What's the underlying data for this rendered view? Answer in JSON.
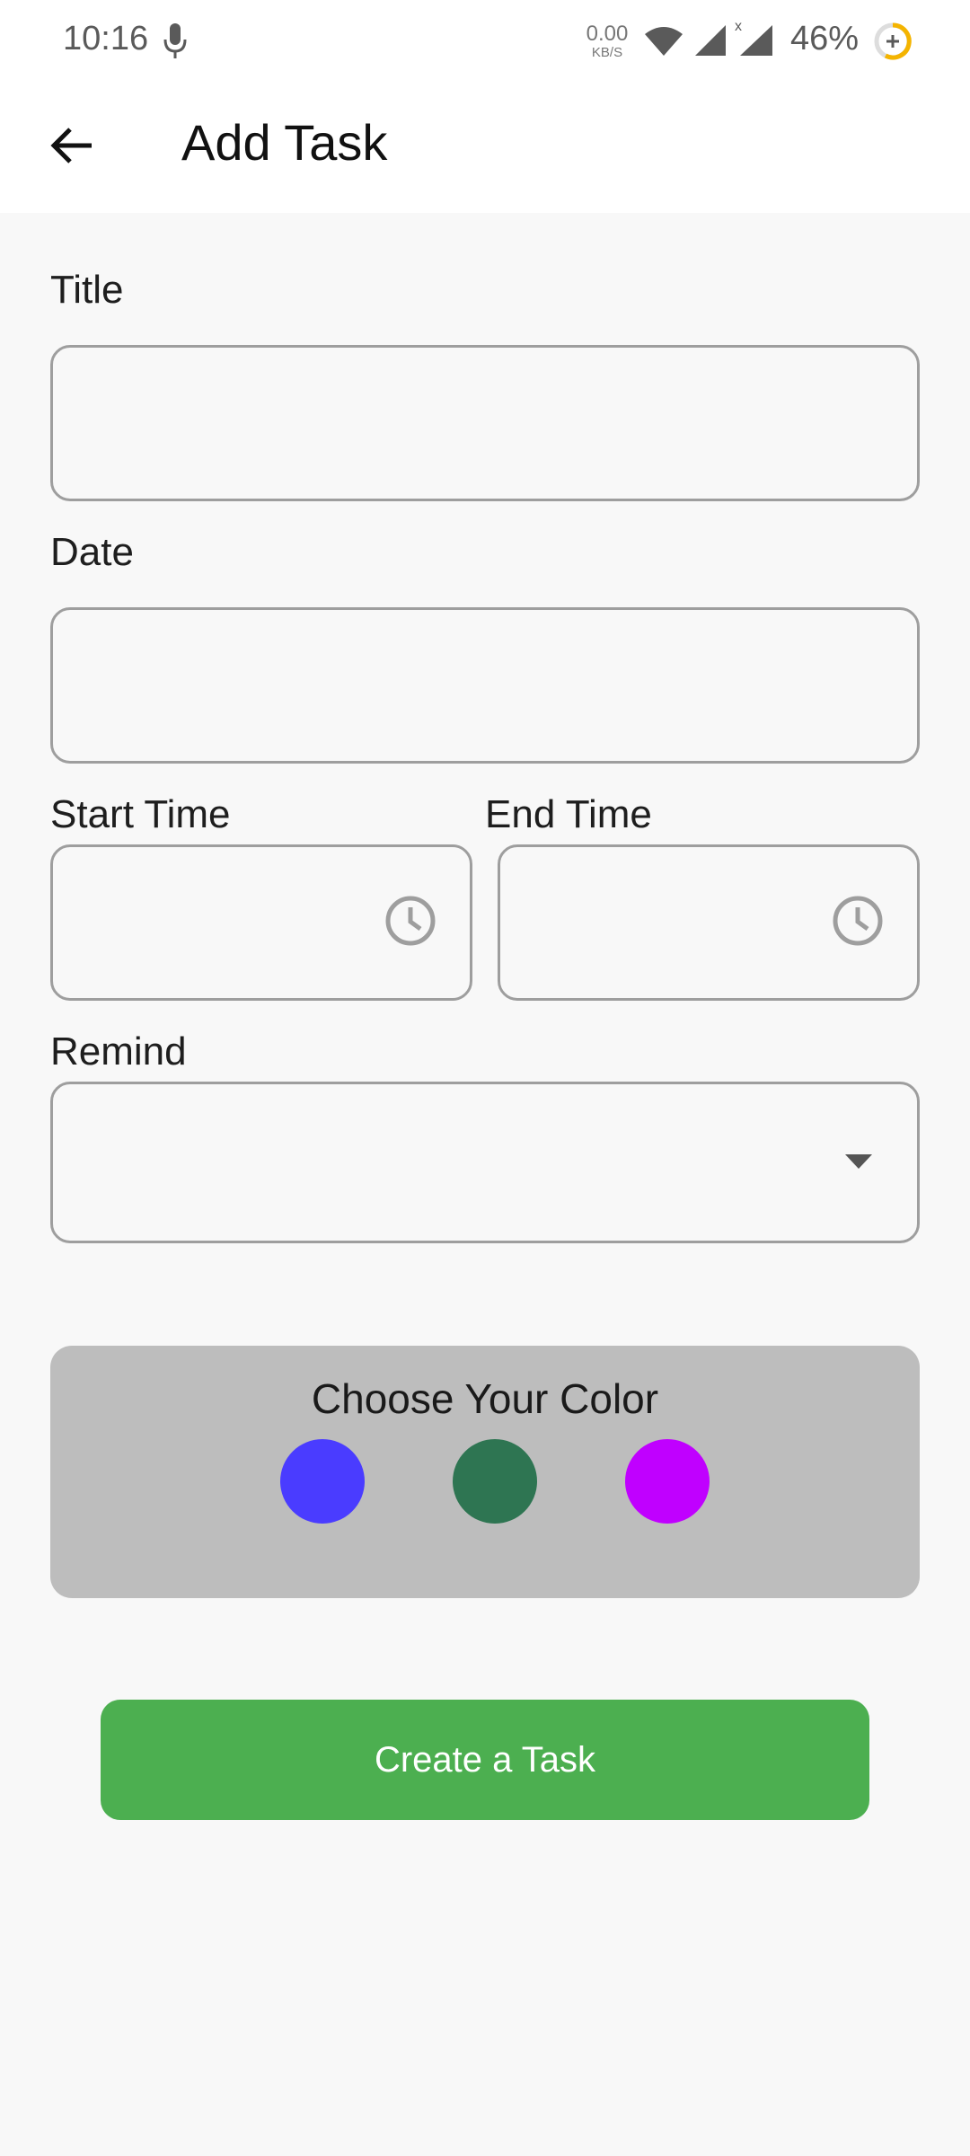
{
  "status_bar": {
    "time": "10:16",
    "net_speed_value": "0.00",
    "net_speed_unit": "KB/S",
    "battery": "46%",
    "icons": [
      "mic-icon",
      "wifi-icon",
      "signal-icon",
      "signal-no-data-icon",
      "battery-saver-icon"
    ]
  },
  "app_bar": {
    "back_icon": "arrow-left-icon",
    "title": "Add Task"
  },
  "form": {
    "title_label": "Title",
    "title_value": "",
    "date_label": "Date",
    "date_value": "",
    "start_time_label": "Start Time",
    "start_time_value": "",
    "end_time_label": "End Time",
    "end_time_value": "",
    "remind_label": "Remind",
    "remind_value": ""
  },
  "color_picker": {
    "title": "Choose Your Color",
    "colors": [
      "#4a3cff",
      "#2e7552",
      "#c000ff"
    ]
  },
  "actions": {
    "create_label": "Create a Task"
  },
  "theme": {
    "accent": "#4caf50",
    "background": "#f8f8f8"
  }
}
